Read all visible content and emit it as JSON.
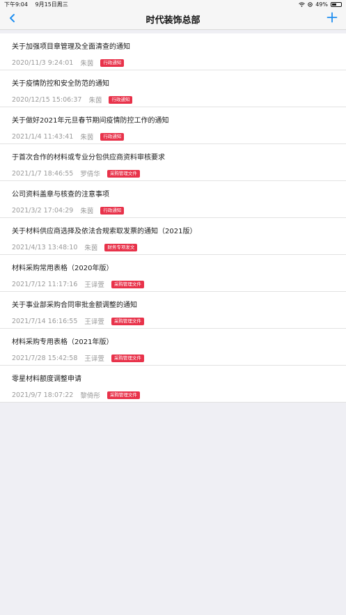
{
  "status_bar": {
    "time": "下午9:04",
    "date": "9月15日周三",
    "battery": "49%"
  },
  "nav": {
    "title": "时代装饰总部",
    "back_icon": "chevron-left-icon",
    "add_icon": "plus-icon"
  },
  "colors": {
    "accent": "#1f8ef0",
    "tag": "#e8324a"
  },
  "notices": [
    {
      "title": "关于加强项目章管理及全面清查的通知",
      "time": "2020/11/3 9:24:01",
      "author": "朱茵",
      "tag": "行政通知"
    },
    {
      "title": "关于疫情防控和安全防范的通知",
      "time": "2020/12/15 15:06:37",
      "author": "朱茵",
      "tag": "行政通知"
    },
    {
      "title": "关于做好2021年元旦春节期间疫情防控工作的通知",
      "time": "2021/1/4 11:43:41",
      "author": "朱茵",
      "tag": "行政通知"
    },
    {
      "title": "于首次合作的材料或专业分包供应商资料审核要求",
      "time": "2021/1/7 18:46:55",
      "author": "罗倩华",
      "tag": "采购管理文件"
    },
    {
      "title": "公司资料盖章与核查的注意事项",
      "time": "2021/3/2 17:04:29",
      "author": "朱茵",
      "tag": "行政通知"
    },
    {
      "title": "关于材料供应商选择及依法合规索取发票的通知（2021版）",
      "time": "2021/4/13 13:48:10",
      "author": "朱茵",
      "tag": "财务专项发文"
    },
    {
      "title": "材料采购常用表格（2020年版）",
      "time": "2021/7/12 11:17:16",
      "author": "王译萱",
      "tag": "采购管理文件"
    },
    {
      "title": "关于事业部采购合同审批金额调整的通知",
      "time": "2021/7/14 16:16:55",
      "author": "王译萱",
      "tag": "采购管理文件"
    },
    {
      "title": "材料采购专用表格（2021年版）",
      "time": "2021/7/28 15:42:58",
      "author": "王译萱",
      "tag": "采购管理文件"
    },
    {
      "title": "零星材料额度调整申请",
      "time": "2021/9/7 18:07:22",
      "author": "黎倚彤",
      "tag": "采购管理文件"
    }
  ]
}
